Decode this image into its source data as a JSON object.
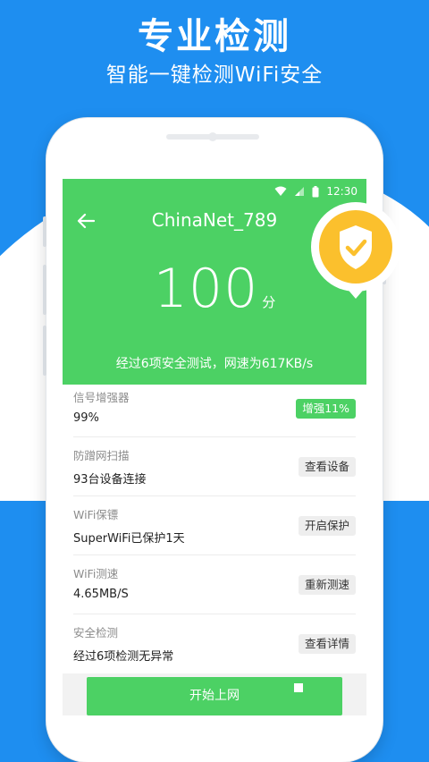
{
  "promo": {
    "headline": "专业检测",
    "subline": "智能一键检测WiFi安全"
  },
  "status_bar": {
    "time": "12:30"
  },
  "header": {
    "ssid": "ChinaNet_789",
    "score": "100",
    "score_unit": "分",
    "summary": "经过6项安全测试，网速为617KB/s"
  },
  "list": [
    {
      "title": "信号增强器",
      "value": "99%",
      "button": "增强11%"
    },
    {
      "title": "防蹭网扫描",
      "value": "93台设备连接",
      "button": "查看设备"
    },
    {
      "title": "WiFi保镖",
      "value": "SuperWiFi已保护1天",
      "button": "开启保护"
    },
    {
      "title": "WiFi测速",
      "value": "4.65MB/S",
      "button": "重新测速"
    },
    {
      "title": "安全检测",
      "value": "经过6项检测无异常",
      "button": "查看详情"
    }
  ],
  "footer": {
    "start_button": "开始上网"
  },
  "colors": {
    "brand_blue": "#1e8ef0",
    "hero_green": "#4cd164",
    "badge_yellow": "#fbc02d",
    "white": "#ffffff"
  }
}
